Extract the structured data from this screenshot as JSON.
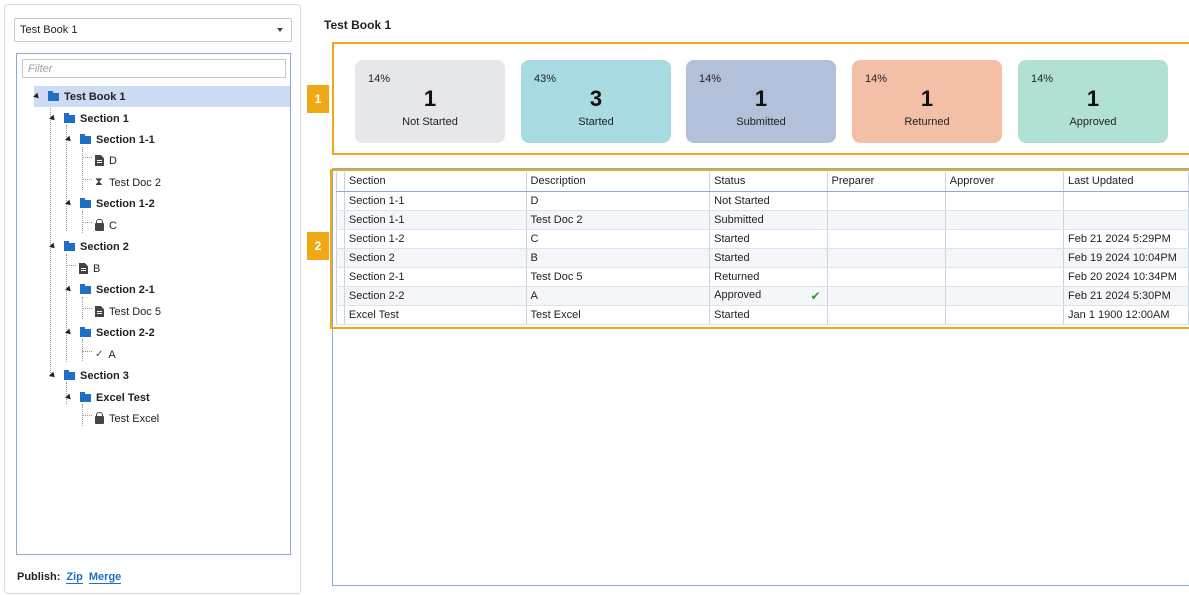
{
  "book_select": {
    "value": "Test Book 1"
  },
  "filter": {
    "placeholder": "Filter"
  },
  "tree": {
    "root": "Test Book 1",
    "section1": "Section 1",
    "section1_1": "Section 1-1",
    "doc_d": "D",
    "doc_testdoc2": "Test Doc 2",
    "section1_2": "Section 1-2",
    "doc_c": "C",
    "section2": "Section 2",
    "doc_b": "B",
    "section2_1": "Section 2-1",
    "doc_testdoc5": "Test Doc 5",
    "section2_2": "Section 2-2",
    "doc_a": "A",
    "section3": "Section 3",
    "excel_test": "Excel Test",
    "doc_testexcel": "Test Excel"
  },
  "publish": {
    "label": "Publish:",
    "zip": "Zip",
    "merge": "Merge"
  },
  "page_title": "Test Book 1",
  "badges": {
    "one": "1",
    "two": "2"
  },
  "cards": [
    {
      "pct": "14%",
      "num": "1",
      "label": "Not Started",
      "color": "#e5e7ea"
    },
    {
      "pct": "43%",
      "num": "3",
      "label": "Started",
      "color": "#a9dbe3"
    },
    {
      "pct": "14%",
      "num": "1",
      "label": "Submitted",
      "color": "#b3c0da"
    },
    {
      "pct": "14%",
      "num": "1",
      "label": "Returned",
      "color": "#f4bfa7"
    },
    {
      "pct": "14%",
      "num": "1",
      "label": "Approved",
      "color": "#b1e1d4"
    }
  ],
  "grid": {
    "headers": [
      "Section",
      "Description",
      "Status",
      "Preparer",
      "Approver",
      "Last Updated"
    ],
    "rows": [
      [
        "Section 1-1",
        "D",
        "Not Started",
        "",
        "",
        ""
      ],
      [
        "Section 1-1",
        "Test Doc 2",
        "Submitted",
        "",
        "",
        ""
      ],
      [
        "Section 1-2",
        "C",
        "Started",
        "",
        "",
        "Feb 21 2024  5:29PM"
      ],
      [
        "Section 2",
        "B",
        "Started",
        "",
        "",
        "Feb 19 2024 10:04PM"
      ],
      [
        "Section 2-1",
        "Test Doc 5",
        "Returned",
        "",
        "",
        "Feb 20 2024 10:34PM"
      ],
      [
        "Section 2-2",
        "A",
        "Approved",
        "",
        "",
        "Feb 21 2024  5:30PM"
      ],
      [
        "Excel Test",
        "Test Excel",
        "Started",
        "",
        "",
        "Jan  1 1900 12:00AM"
      ]
    ]
  },
  "colors": {
    "accent": "#f0a817",
    "folder": "#1f6fc4",
    "selected": "#cddcf4",
    "check": "#2a9d2a"
  }
}
